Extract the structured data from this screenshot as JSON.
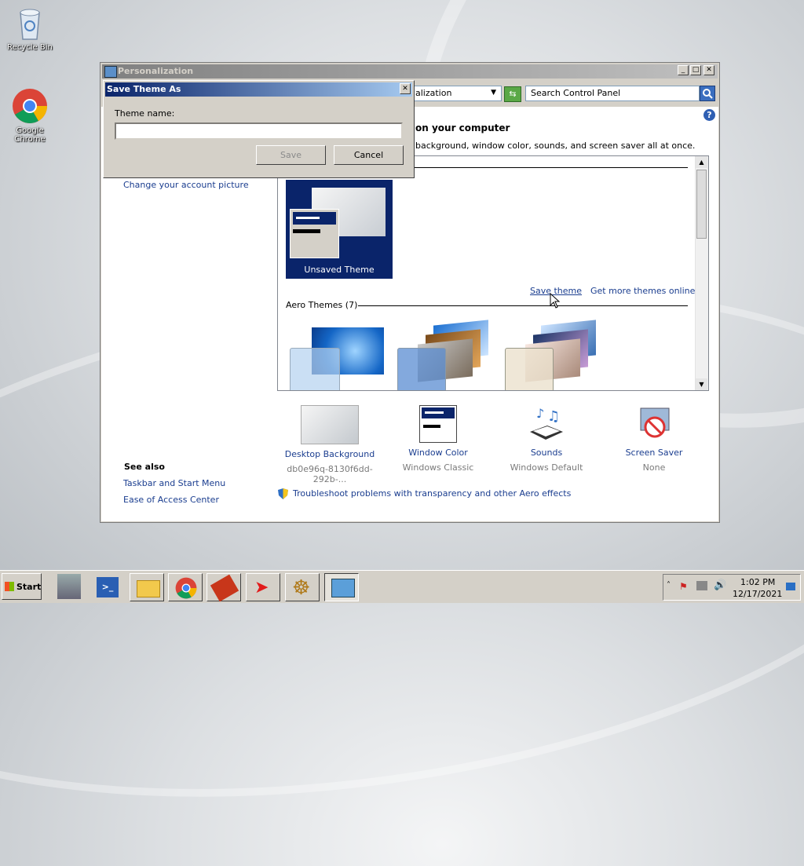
{
  "desktop": {
    "icons": [
      {
        "label": "Recycle Bin"
      },
      {
        "label": "Google Chrome"
      }
    ]
  },
  "window": {
    "title": "Personalization",
    "address_text": "alization",
    "search_placeholder": "Search Control Panel",
    "heading_fragment": "on your computer",
    "desc_fragment": "background, window color, sounds, and screen saver all at once.",
    "sidebar": {
      "change_account_picture": "Change your account picture",
      "see_also": "See also",
      "links": [
        "Taskbar and Start Menu",
        "Ease of Access Center"
      ]
    },
    "themes": {
      "unsaved_label": "Unsaved Theme",
      "save_theme": "Save theme",
      "get_more": "Get more themes online",
      "aero_header": "Aero Themes (7)"
    },
    "bottom": [
      {
        "label": "Desktop Background",
        "sub": "db0e96q-8130f6dd-292b-..."
      },
      {
        "label": "Window Color",
        "sub": "Windows Classic"
      },
      {
        "label": "Sounds",
        "sub": "Windows Default"
      },
      {
        "label": "Screen Saver",
        "sub": "None"
      }
    ],
    "troubleshoot": "Troubleshoot problems with transparency and other Aero effects"
  },
  "dialog": {
    "title": "Save Theme As",
    "field_label": "Theme name:",
    "field_value": "",
    "save_label": "Save",
    "cancel_label": "Cancel"
  },
  "taskbar": {
    "start_label": "Start",
    "time": "1:02 PM",
    "date": "12/17/2021"
  },
  "colors": {
    "dialog_title_start": "#0a246a",
    "dialog_title_end": "#a6caf0",
    "link": "#1a3d8f",
    "selected_theme_bg": "#0a246a"
  }
}
